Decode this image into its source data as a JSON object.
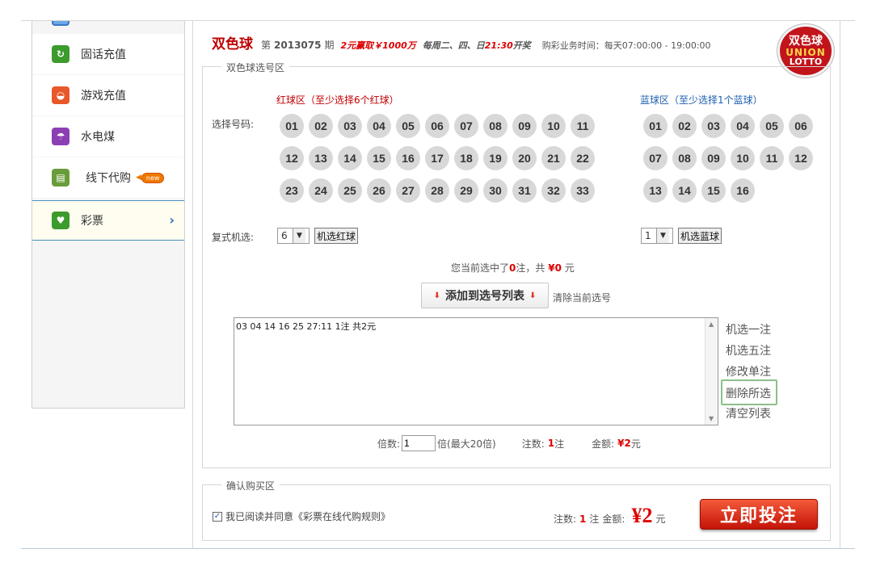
{
  "sidebar": {
    "items": [
      {
        "label": "固话充值",
        "icon": "phone-recharge-icon",
        "color": "#3c9b2c",
        "glyph": "↻"
      },
      {
        "label": "游戏充值",
        "icon": "game-controller-icon",
        "color": "#e8582a",
        "glyph": "◒"
      },
      {
        "label": "水电煤",
        "icon": "utilities-icon",
        "color": "#8b3fb3",
        "glyph": "☂"
      },
      {
        "label": "线下代购",
        "icon": "shopping-cart-icon",
        "color": "#6a9c3a",
        "glyph": "▤",
        "badge": "new"
      },
      {
        "label": "彩票",
        "icon": "lottery-icon",
        "color": "#3c9b2c",
        "glyph": "♥"
      }
    ]
  },
  "header": {
    "game": "双色球",
    "issue_prefix": "第",
    "issue": "2013075",
    "issue_suffix": "期",
    "promo": "2元赢取￥1000万",
    "schedule_days": "每周二、四、日",
    "schedule_time": "21:30",
    "schedule_suffix": "开奖",
    "hours": "购彩业务时间：每天07:00:00 - 19:00:00"
  },
  "logo": {
    "line1": "双色球",
    "line2": "UNION",
    "line3": "LOTTO"
  },
  "selection": {
    "legend": "双色球选号区",
    "red_title": "红球区（至少选择6个红球）",
    "blue_title": "蓝球区（至少选择1个蓝球）",
    "pick_label": "选择号码:",
    "red_balls": [
      "01",
      "02",
      "03",
      "04",
      "05",
      "06",
      "07",
      "08",
      "09",
      "10",
      "11",
      "12",
      "13",
      "14",
      "15",
      "16",
      "17",
      "18",
      "19",
      "20",
      "21",
      "22",
      "23",
      "24",
      "25",
      "26",
      "27",
      "28",
      "29",
      "30",
      "31",
      "32",
      "33"
    ],
    "blue_balls": [
      "01",
      "02",
      "03",
      "04",
      "05",
      "06",
      "07",
      "08",
      "09",
      "10",
      "11",
      "12",
      "13",
      "14",
      "15",
      "16"
    ],
    "multi_label": "复式机选:",
    "red_count": "6",
    "red_random_button": "机选红球",
    "blue_count": "1",
    "blue_random_button": "机选蓝球",
    "summary_prefix": "您当前选中了",
    "summary_count": "0",
    "summary_mid": "注，共",
    "summary_amount": "¥0",
    "summary_suffix": "元",
    "add_button": "添加到选号列表",
    "clear_current": "清除当前选号",
    "list_entry": "03 04 14 16 25 27:11 1注 共2元",
    "side_actions": [
      "机选一注",
      "机选五注",
      "修改单注",
      "删除所选",
      "清空列表"
    ],
    "multiplier_label": "倍数:",
    "multiplier_value": "1",
    "multiplier_max": "倍(最大20倍)",
    "bets_label": "注数:",
    "bets_value": "1",
    "bets_unit": "注",
    "amount_label": "金额:",
    "amount_value": "¥2",
    "amount_unit": "元"
  },
  "confirm": {
    "legend": "确认购买区",
    "agree_text": "我已阅读并同意《彩票在线代购规则》",
    "bets_label": "注数:",
    "bets_value": "1",
    "bets_unit": "注",
    "amount_label": "金额:",
    "amount_value": "¥2",
    "amount_unit": "元",
    "buy_button": "立即投注"
  }
}
